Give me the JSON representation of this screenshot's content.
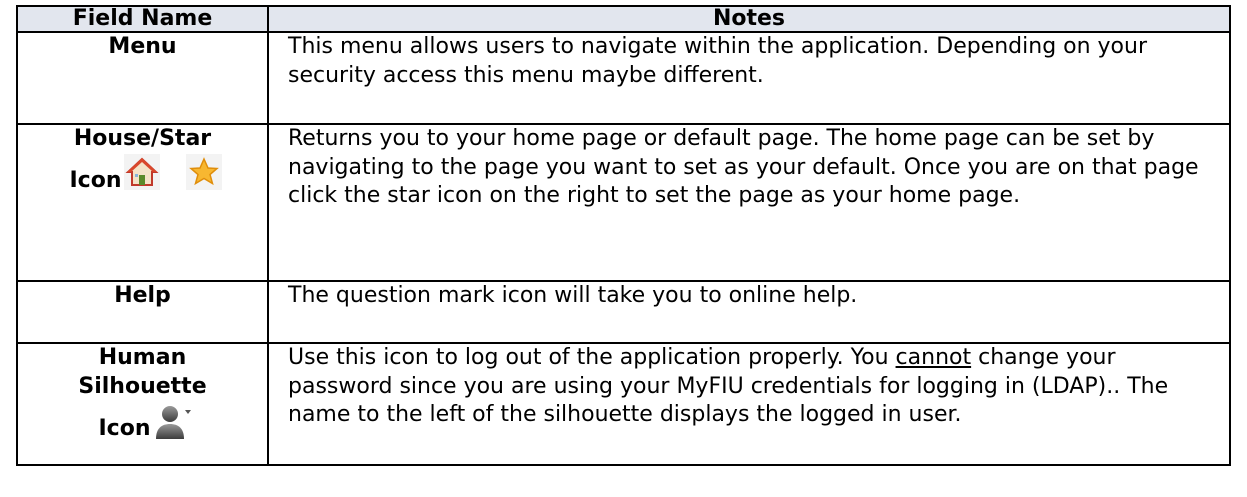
{
  "table": {
    "headers": [
      "Field Name",
      "Notes"
    ],
    "rows": [
      {
        "field": "Menu",
        "notes": "This menu allows users to navigate within the application. Depending on your security access this menu maybe different."
      },
      {
        "field_line1": "House/Star",
        "field_line2": "Icon",
        "icons": [
          "house-icon",
          "star-icon"
        ],
        "notes": "Returns you to your home page or default page. The home page can be set by navigating to the page you want to set as your default.  Once you are on that page click the star icon on the right to set the page as your home page."
      },
      {
        "field": "Help",
        "notes": "The question mark icon will take you to online help."
      },
      {
        "field_line1": "Human",
        "field_line2": "Silhouette",
        "field_line3": "Icon",
        "icons": [
          "person-silhouette-icon"
        ],
        "notes_part1": "Use this icon to log out of the application properly.  You ",
        "notes_underlined": "cannot",
        "notes_part2": " change your password since you are using your MyFIU credentials for logging in (LDAP).. The name to the left of the silhouette displays the logged in user."
      }
    ]
  },
  "colors": {
    "header_bg": "#e2e6ee",
    "border": "#000000"
  }
}
